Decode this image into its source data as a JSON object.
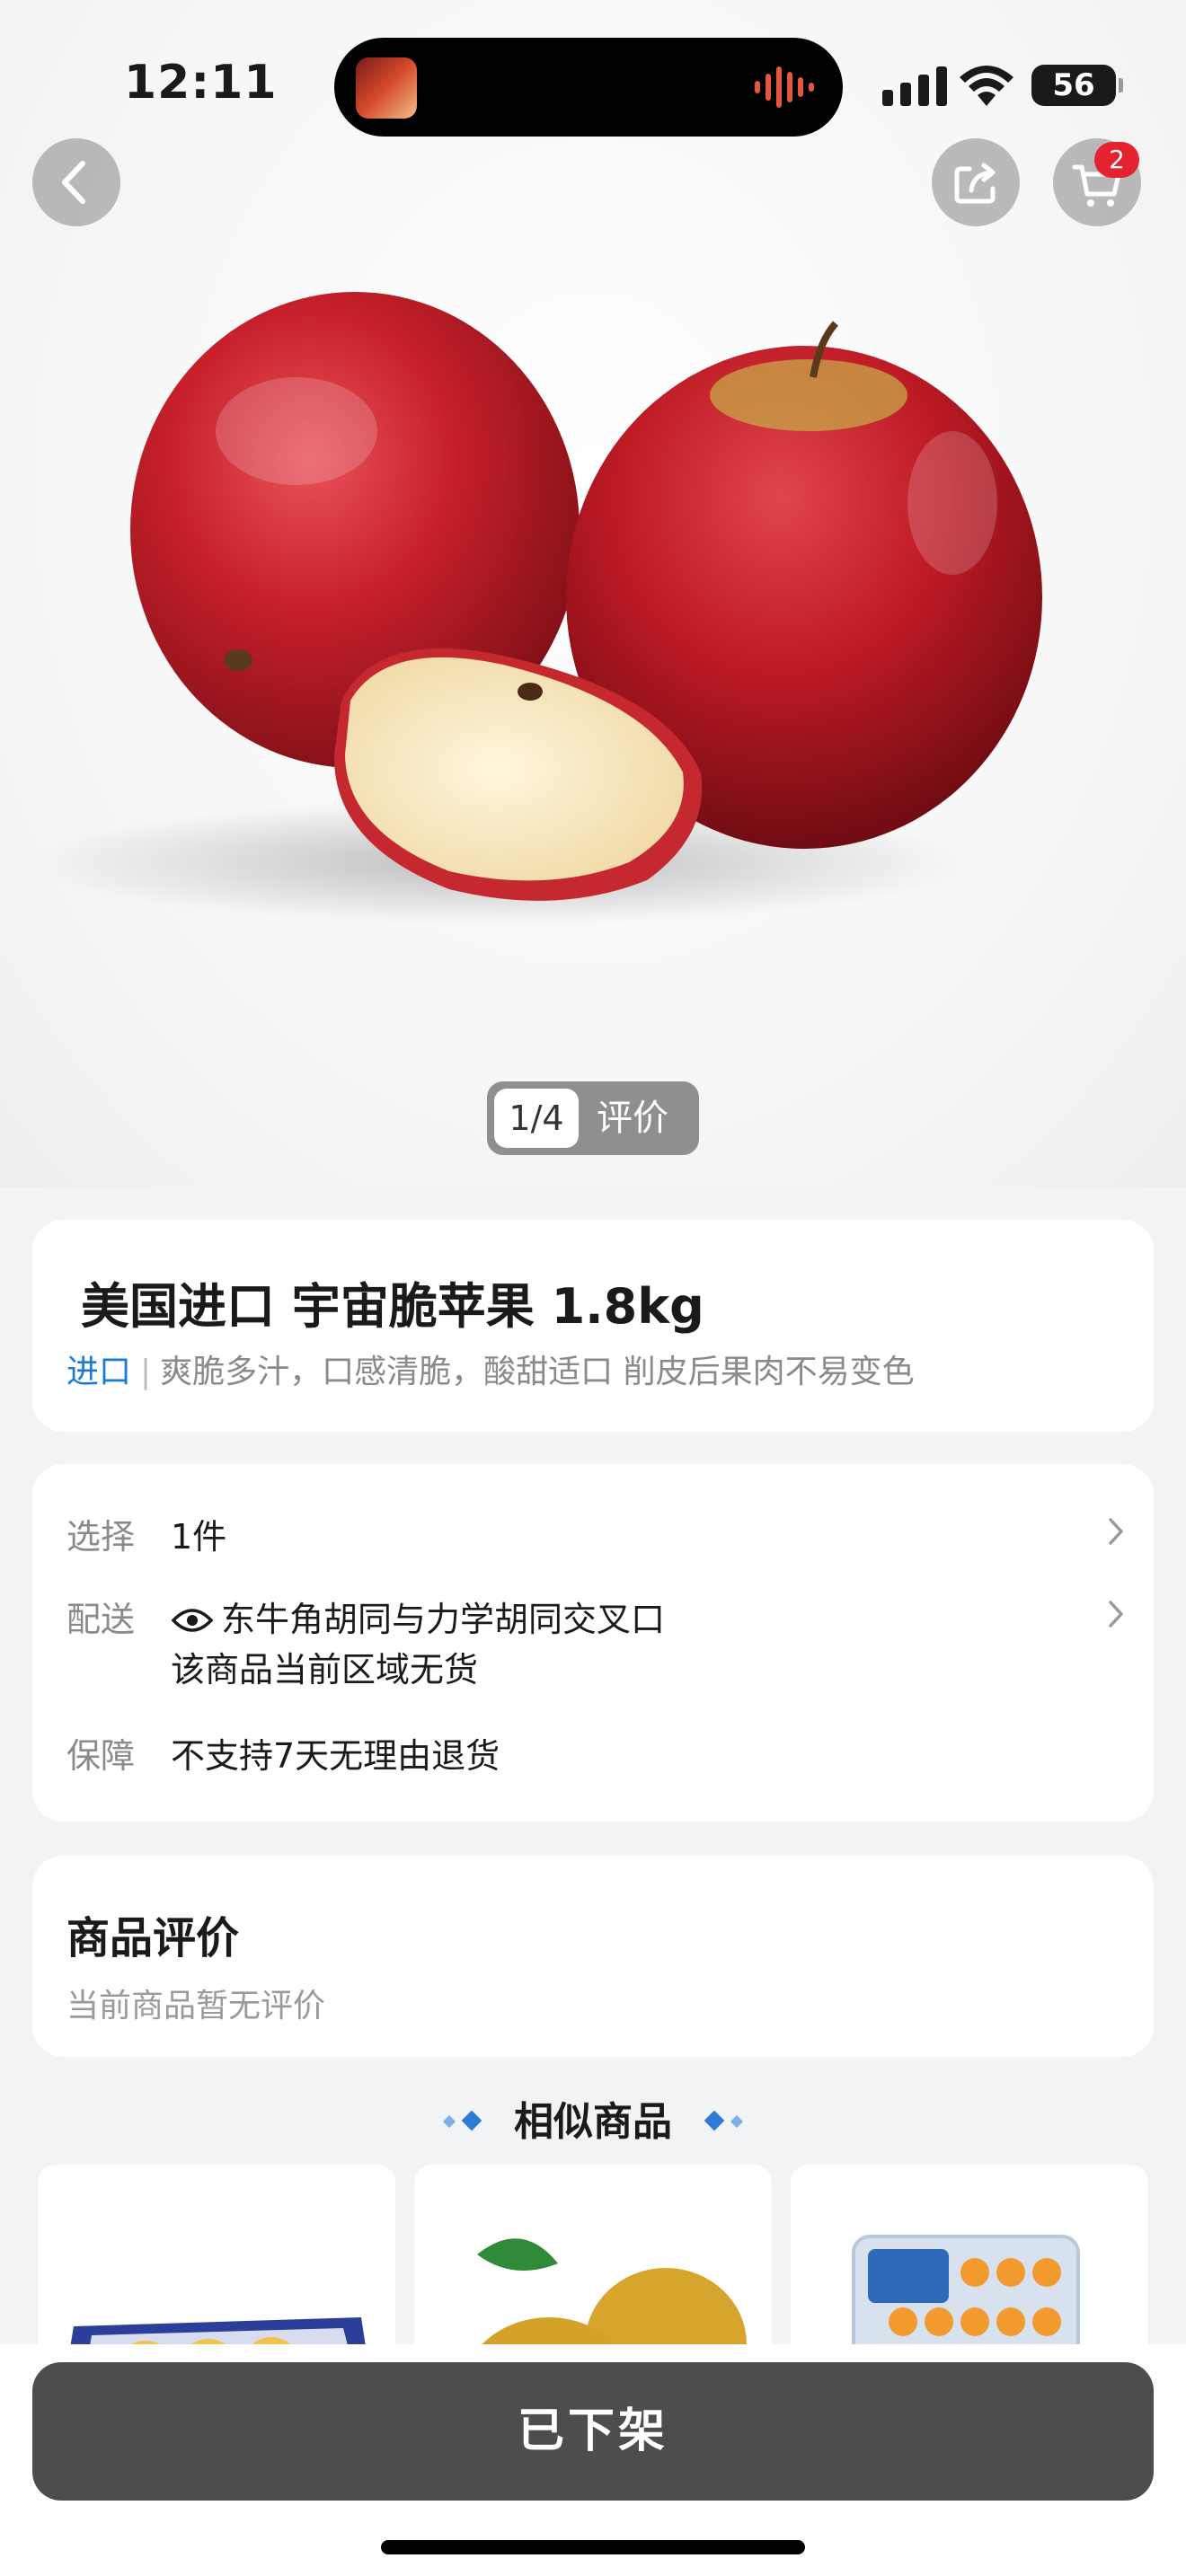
{
  "status_bar": {
    "time": "12:11",
    "battery": "56"
  },
  "header": {
    "cart_count": "2"
  },
  "gallery": {
    "counter": "1/4",
    "review_label": "评价"
  },
  "product": {
    "title": "美国进口 宇宙脆苹果 1.8kg",
    "tag": "进口",
    "subtitle": "爽脆多汁，口感清脆，酸甜适口 削皮后果肉不易变色"
  },
  "info": {
    "select_label": "选择",
    "select_value": "1件",
    "delivery_label": "配送",
    "delivery_address": "东牛角胡同与力学胡同交叉口",
    "delivery_note": "该商品当前区域无货",
    "guarantee_label": "保障",
    "guarantee_value": "不支持7天无理由退货"
  },
  "reviews": {
    "title": "商品评价",
    "empty": "当前商品暂无评价"
  },
  "similar": {
    "title": "相似商品"
  },
  "bottom": {
    "button": "已下架"
  },
  "colors": {
    "tag_blue": "#1a7bd6",
    "badge_red": "#e5222f",
    "button_gray": "#4c4d4f"
  },
  "icons": [
    "back-icon",
    "share-icon",
    "cart-icon",
    "eye-icon",
    "chevron-right-icon"
  ]
}
